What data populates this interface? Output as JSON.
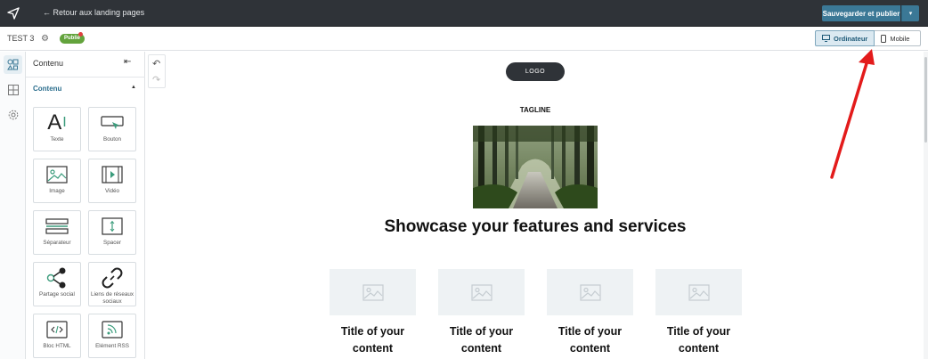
{
  "topbar": {
    "back_label": "← Retour aux landing pages",
    "save_label": "Sauvegarder et publier",
    "save_caret": "▾"
  },
  "subbar": {
    "page_name": "TEST 3",
    "status_badge": "Publié",
    "device_desktop": "Ordinateur",
    "device_mobile": "Mobile"
  },
  "rail": {
    "items": [
      "content-icon",
      "layout-icon",
      "settings-icon"
    ]
  },
  "panel": {
    "title": "Contenu",
    "section": "Contenu",
    "tiles": [
      {
        "label": "Texte",
        "icon": "text-icon"
      },
      {
        "label": "Bouton",
        "icon": "button-icon"
      },
      {
        "label": "Image",
        "icon": "image-icon"
      },
      {
        "label": "Vidéo",
        "icon": "video-icon"
      },
      {
        "label": "Séparateur",
        "icon": "divider-icon"
      },
      {
        "label": "Spacer",
        "icon": "spacer-icon"
      },
      {
        "label": "Partage social",
        "icon": "share-icon"
      },
      {
        "label": "Liens de réseaux sociaux",
        "icon": "link-icon"
      },
      {
        "label": "Bloc HTML",
        "icon": "html-icon"
      },
      {
        "label": "Elément RSS",
        "icon": "rss-icon"
      }
    ]
  },
  "canvas": {
    "logo": "LOGO",
    "tagline": "TAGLINE",
    "headline": "Showcase your features and services",
    "features": [
      {
        "title": "Title of your content"
      },
      {
        "title": "Title of your content"
      },
      {
        "title": "Title of your content"
      },
      {
        "title": "Title of your content"
      }
    ]
  },
  "colors": {
    "topbar": "#2f3338",
    "accent": "#3b7896",
    "published": "#63a33c",
    "annotation_arrow": "#e31b1b"
  }
}
